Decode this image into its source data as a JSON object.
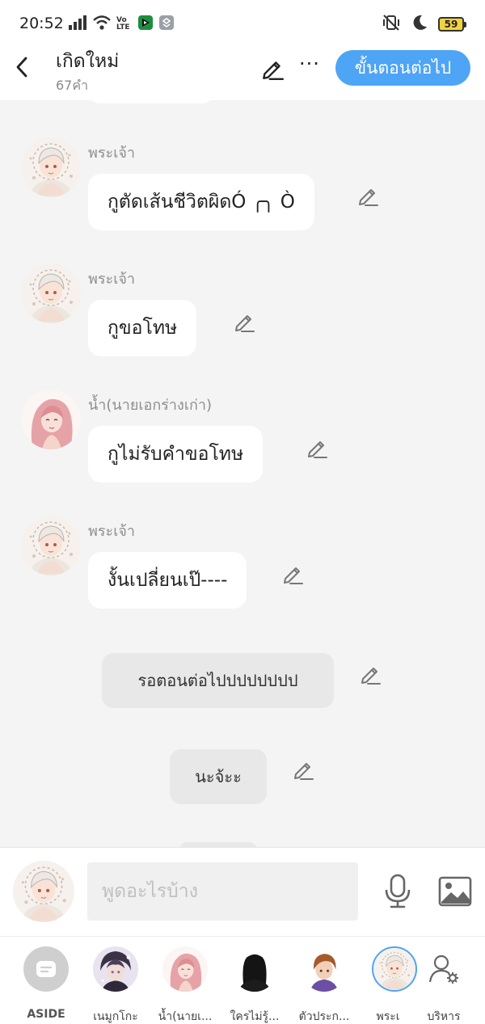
{
  "status_bar": {
    "time": "20:52",
    "volte_label": "Vo LTE",
    "battery": "59"
  },
  "header": {
    "title": "เกิดใหม่",
    "subtitle": "67คำ",
    "next_button": "ขั้นตอนต่อไป",
    "more_label": "···"
  },
  "messages": [
    {
      "type": "dialogue",
      "speaker": "พระเจ้า",
      "text": "กูตัดเส้นชีวิตผิดÓ ╭╮ Ò",
      "avatar": "god-avatar"
    },
    {
      "type": "dialogue",
      "speaker": "พระเจ้า",
      "text": "กูขอโทษ",
      "avatar": "god-avatar"
    },
    {
      "type": "dialogue",
      "speaker": "น้ำ(นายเอกร่างเก่า)",
      "text": "กูไม่รับคำขอโทษ",
      "avatar": "nam-avatar"
    },
    {
      "type": "dialogue",
      "speaker": "พระเจ้า",
      "text": "งั้นเปลี่ยนเป๊----",
      "avatar": "god-avatar"
    },
    {
      "type": "narration",
      "text": "รอตอนต่อไปปปปปปปป"
    },
    {
      "type": "narration",
      "text": "นะจ้ะะ"
    }
  ],
  "composer": {
    "placeholder": "พูดอะไรบ้าง"
  },
  "characters": [
    {
      "label": "ASIDE",
      "icon": "aside-icon"
    },
    {
      "label": "เนมูกโกะ",
      "icon": "nemuko-avatar"
    },
    {
      "label": "น้ำ(นายเ...",
      "icon": "nam-avatar"
    },
    {
      "label": "ใครไม่รู้...",
      "icon": "unknown-avatar"
    },
    {
      "label": "ตัวประก...",
      "icon": "extra-avatar"
    },
    {
      "label": "พระเ",
      "icon": "god-avatar"
    },
    {
      "label": "บริหาร",
      "icon": "manage-icon"
    }
  ],
  "colors": {
    "accent": "#4ea4f5",
    "background": "#f4f4f4",
    "bubble": "#ffffff",
    "narration": "#e8e8e8"
  }
}
